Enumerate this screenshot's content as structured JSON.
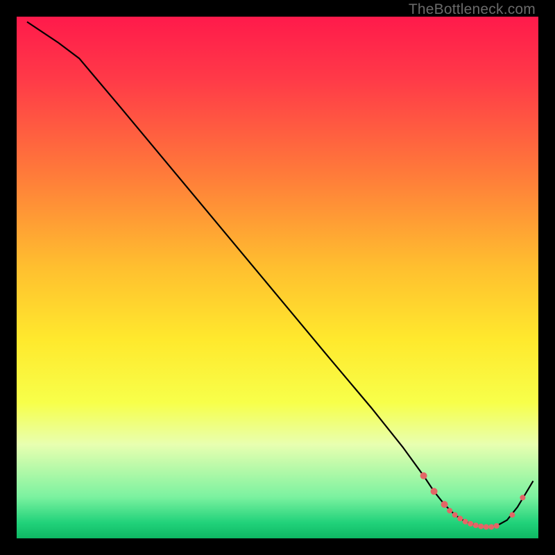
{
  "watermark": "TheBottleneck.com",
  "colors": {
    "bg": "#000000",
    "line": "#000000",
    "marker": "#e36666",
    "gradient_stops": [
      {
        "offset": 0.0,
        "color": "#ff1a4b"
      },
      {
        "offset": 0.12,
        "color": "#ff3a48"
      },
      {
        "offset": 0.3,
        "color": "#ff7a3a"
      },
      {
        "offset": 0.48,
        "color": "#ffbf2f"
      },
      {
        "offset": 0.62,
        "color": "#ffe92d"
      },
      {
        "offset": 0.74,
        "color": "#f7ff4a"
      },
      {
        "offset": 0.82,
        "color": "#e8ffb0"
      },
      {
        "offset": 0.92,
        "color": "#7cf2a0"
      },
      {
        "offset": 0.97,
        "color": "#21d27a"
      },
      {
        "offset": 1.0,
        "color": "#0eb864"
      }
    ]
  },
  "chart_data": {
    "type": "line",
    "title": "",
    "xlabel": "",
    "ylabel": "",
    "xlim": [
      0,
      100
    ],
    "ylim": [
      0,
      100
    ],
    "grid": false,
    "series": [
      {
        "name": "curve",
        "x": [
          2,
          5,
          8,
          12,
          20,
          30,
          40,
          50,
          60,
          68,
          74,
          78,
          80,
          82,
          84,
          86,
          88,
          90,
          92,
          94,
          96,
          99
        ],
        "y": [
          99,
          97,
          95,
          92,
          82.5,
          70.5,
          58.5,
          46.5,
          34.5,
          25,
          17.5,
          12,
          9,
          6.5,
          4.5,
          3.2,
          2.5,
          2.2,
          2.4,
          3.5,
          6,
          11
        ]
      }
    ],
    "markers": {
      "name": "highlight-points",
      "x": [
        78,
        80,
        82,
        83,
        84,
        85,
        86,
        87,
        88,
        89,
        90,
        91,
        92,
        95,
        97
      ],
      "y": [
        12,
        9,
        6.5,
        5.3,
        4.5,
        3.8,
        3.2,
        2.8,
        2.5,
        2.3,
        2.2,
        2.2,
        2.4,
        4.5,
        7.8
      ],
      "r": [
        5,
        5,
        5,
        4,
        4,
        4,
        4,
        4,
        4,
        4,
        4,
        4,
        4,
        4,
        4
      ]
    }
  }
}
